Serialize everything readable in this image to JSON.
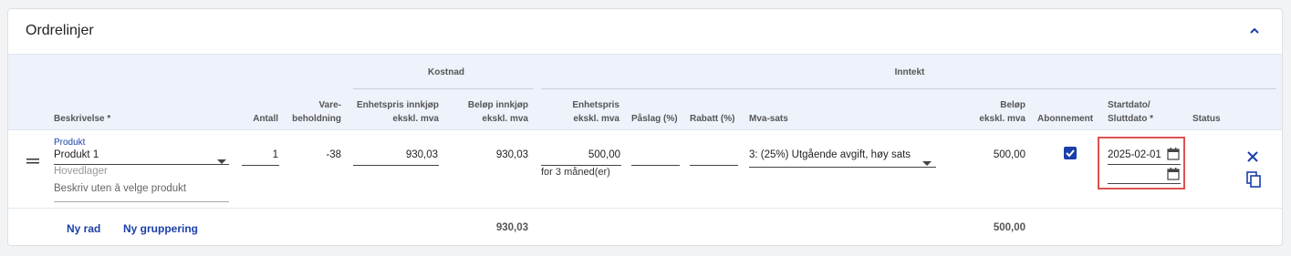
{
  "panel": {
    "title": "Ordrelinjer",
    "collapse_icon": "chevron-up-icon"
  },
  "groups": {
    "cost": "Kostnad",
    "income": "Inntekt"
  },
  "columns": {
    "description": "Beskrivelse *",
    "quantity": "Antall",
    "stock_line1": "Vare-",
    "stock_line2": "beholdning",
    "unit_cost_line1": "Enhetspris innkjøp",
    "unit_cost_line2": "ekskl. mva",
    "cost_amount_line1": "Beløp innkjøp",
    "cost_amount_line2": "ekskl. mva",
    "unit_price_line1": "Enhetspris",
    "unit_price_line2": "ekskl. mva",
    "markup": "Påslag (%)",
    "discount": "Rabatt (%)",
    "vat": "Mva-sats",
    "amount_line1": "Beløp",
    "amount_line2": "ekskl. mva",
    "subscription": "Abonnement",
    "dates_line1": "Startdato/",
    "dates_line2": "Sluttdato *",
    "status": "Status"
  },
  "row": {
    "product_label": "Produkt",
    "product_value": "Produkt 1",
    "warehouse": "Hovedlager",
    "description_placeholder": "Beskriv uten å velge produkt",
    "quantity": "1",
    "stock": "-38",
    "unit_cost": "930,03",
    "cost_amount": "930,03",
    "unit_price": "500,00",
    "period_note": "for 3 måned(er)",
    "markup": "",
    "discount": "",
    "vat": "3: (25%) Utgående avgift, høy sats",
    "amount": "500,00",
    "subscription_checked": true,
    "start_date": "2025-02-01",
    "end_date": ""
  },
  "footer": {
    "new_row": "Ny rad",
    "new_group": "Ny gruppering",
    "cost_total": "930,03",
    "amount_total": "500,00"
  },
  "colors": {
    "accent": "#1a3fa8",
    "header_bg": "#eef2fb",
    "highlight": "#d9534f"
  }
}
